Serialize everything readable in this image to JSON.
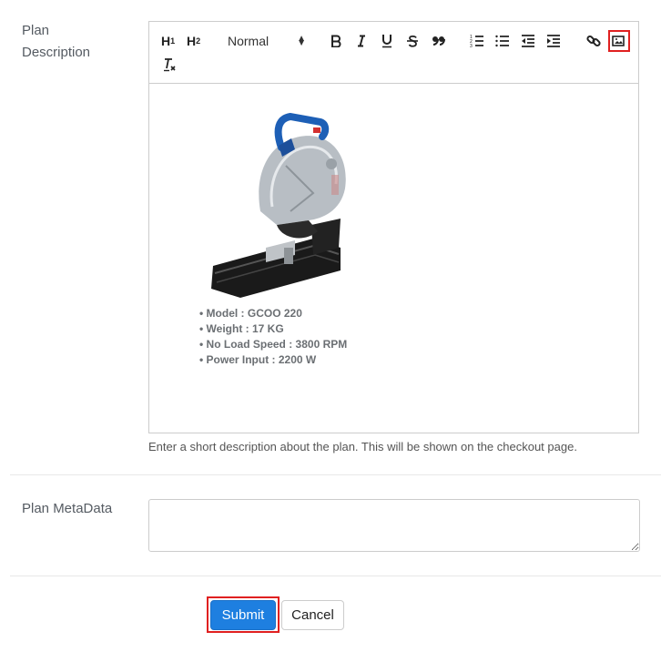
{
  "plan_description": {
    "label_line1": "Plan",
    "label_line2": "Description",
    "toolbar": {
      "h1": "H",
      "h1_sub": "1",
      "h2": "H",
      "h2_sub": "2",
      "header_select": "Normal",
      "icons": [
        "bold-icon",
        "italic-icon",
        "underline-icon",
        "strike-icon",
        "blockquote-icon",
        "ordered-list-icon",
        "bullet-list-icon",
        "outdent-icon",
        "indent-icon",
        "link-icon",
        "image-icon",
        "clear-format-icon"
      ]
    },
    "content": {
      "image_alt": "Cut-off saw product image",
      "specs": [
        "Model : GCOO 220",
        "Weight : 17 KG",
        "No Load Speed : 3800 RPM",
        "Power Input : 2200 W"
      ]
    },
    "hint": "Enter a short description about the plan. This will be shown on the checkout page."
  },
  "plan_metadata": {
    "label": "Plan MetaData",
    "value": ""
  },
  "actions": {
    "submit_label": "Submit",
    "cancel_label": "Cancel"
  },
  "colors": {
    "primary": "#1e7fe0",
    "highlight": "#e02020"
  }
}
